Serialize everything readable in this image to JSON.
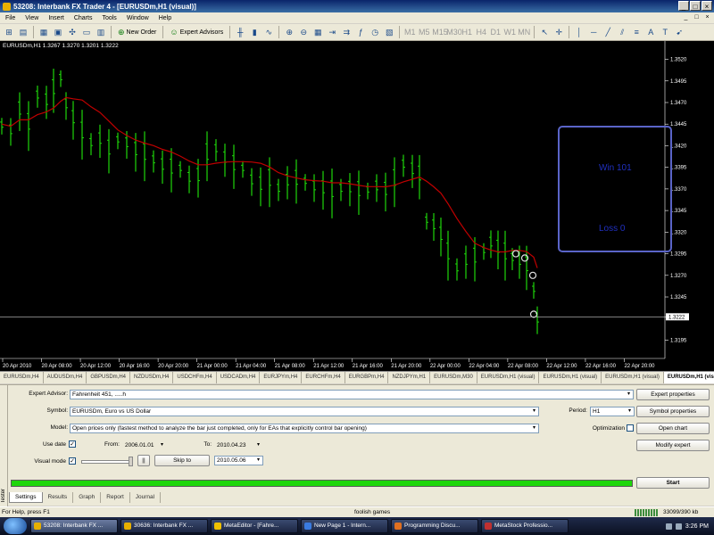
{
  "window": {
    "title": "53208: Interbank FX Trader 4 - [EURUSDm,H1 (visual)]",
    "controls": [
      "_",
      "□",
      "×"
    ]
  },
  "menu": [
    "File",
    "View",
    "Insert",
    "Charts",
    "Tools",
    "Window",
    "Help"
  ],
  "menu_right_controls": [
    "_",
    "□",
    "×"
  ],
  "toolbar": {
    "new_order": "New Order",
    "expert_advisors": "Expert Advisors",
    "timeframes": [
      "M1",
      "M5",
      "M15",
      "M30",
      "H1",
      "H4",
      "D1",
      "W1",
      "MN"
    ]
  },
  "chart": {
    "header": "EURUSDm,H1  1.3267 1.3270 1.3201 1.3222",
    "win_label": "Win  101",
    "loss_label": "Loss  0",
    "price_labels": [
      "1.3520",
      "1.3495",
      "1.3470",
      "1.3445",
      "1.3420",
      "1.3395",
      "1.3370",
      "1.3345",
      "1.3320",
      "1.3295",
      "1.3270",
      "1.3245",
      "1.3222",
      "1.3195"
    ],
    "current_price": "1.3222",
    "time_labels": [
      "20 Apr 2010",
      "20 Apr 08:00",
      "20 Apr 12:00",
      "20 Apr 16:00",
      "20 Apr 20:00",
      "21 Apr 00:00",
      "21 Apr 04:00",
      "21 Apr 08:00",
      "21 Apr 12:00",
      "21 Apr 16:00",
      "21 Apr 20:00",
      "22 Apr 00:00",
      "22 Apr 04:00",
      "22 Apr 08:00",
      "22 Apr 12:00",
      "22 Apr 16:00",
      "22 Apr 20:00"
    ],
    "colors": {
      "background": "#000000",
      "bars": "#1ed60a",
      "moving_average": "#c00000",
      "win_loss_text": "#2030c0"
    }
  },
  "chart_tabs": [
    "EURUSDm,H4",
    "AUDUSDm,H4",
    "GBPUSDm,H4",
    "NZDUSDm,H4",
    "USDCHFm,H4",
    "USDCADm,H4",
    "EURJPYm,H4",
    "EURCHFm,H4",
    "EURGBPm,H4",
    "NZDJPYm,H1",
    "EURUSDm,M30",
    "EURUSDm,H1 (visual)",
    "EURUSDm,H1 (visual)",
    "EURUSDm,H1 (visual)",
    "EURUSDm,H1 (visual)"
  ],
  "tester": {
    "side_label": "Tester",
    "expert_advisor_label": "Expert Advisor:",
    "expert_advisor_value": "Fahrenheit 451, .....h",
    "symbol_label": "Symbol:",
    "symbol_value": "EURUSDm, Euro vs US Dollar",
    "model_label": "Model:",
    "model_value": "Open prices only (fastest method to analyze the bar just completed, only for EAs that explicitly control bar opening)",
    "use_date_label": "Use date",
    "use_date_checked": "✓",
    "from_label": "From:",
    "from_value": "2006.01.01",
    "to_label": "To:",
    "to_value": "2010.04.23",
    "visual_mode_label": "Visual mode",
    "visual_mode_checked": "✓",
    "pause_label": "||",
    "skip_to_label": "Skip to",
    "skip_to_value": "2010.05.06",
    "period_label": "Period:",
    "period_value": "H1",
    "optimization_label": "Optimization",
    "buttons": {
      "expert_properties": "Expert properties",
      "symbol_properties": "Symbol properties",
      "open_chart": "Open chart",
      "modify_expert": "Modify expert",
      "start": "Start"
    },
    "progress": 1.0,
    "tabs": [
      "Settings",
      "Results",
      "Graph",
      "Report",
      "Journal"
    ]
  },
  "status": {
    "help": "For Help, press F1",
    "profile": "foolish games",
    "traffic": "33099/390 kb"
  },
  "taskbar": {
    "tasks": [
      {
        "label": "53208: Interbank FX ...",
        "color": "#e8b000"
      },
      {
        "label": "30636: Interbank FX ...",
        "color": "#e8b000"
      },
      {
        "label": "MetaEditor - [Fahre...",
        "color": "#f0c000"
      },
      {
        "label": "New Page 1 - Intern...",
        "color": "#3a7be0"
      },
      {
        "label": "Programming Discu...",
        "color": "#e07020"
      },
      {
        "label": "MetaStock Professio...",
        "color": "#c03030"
      }
    ],
    "clock": "3:26 PM"
  }
}
